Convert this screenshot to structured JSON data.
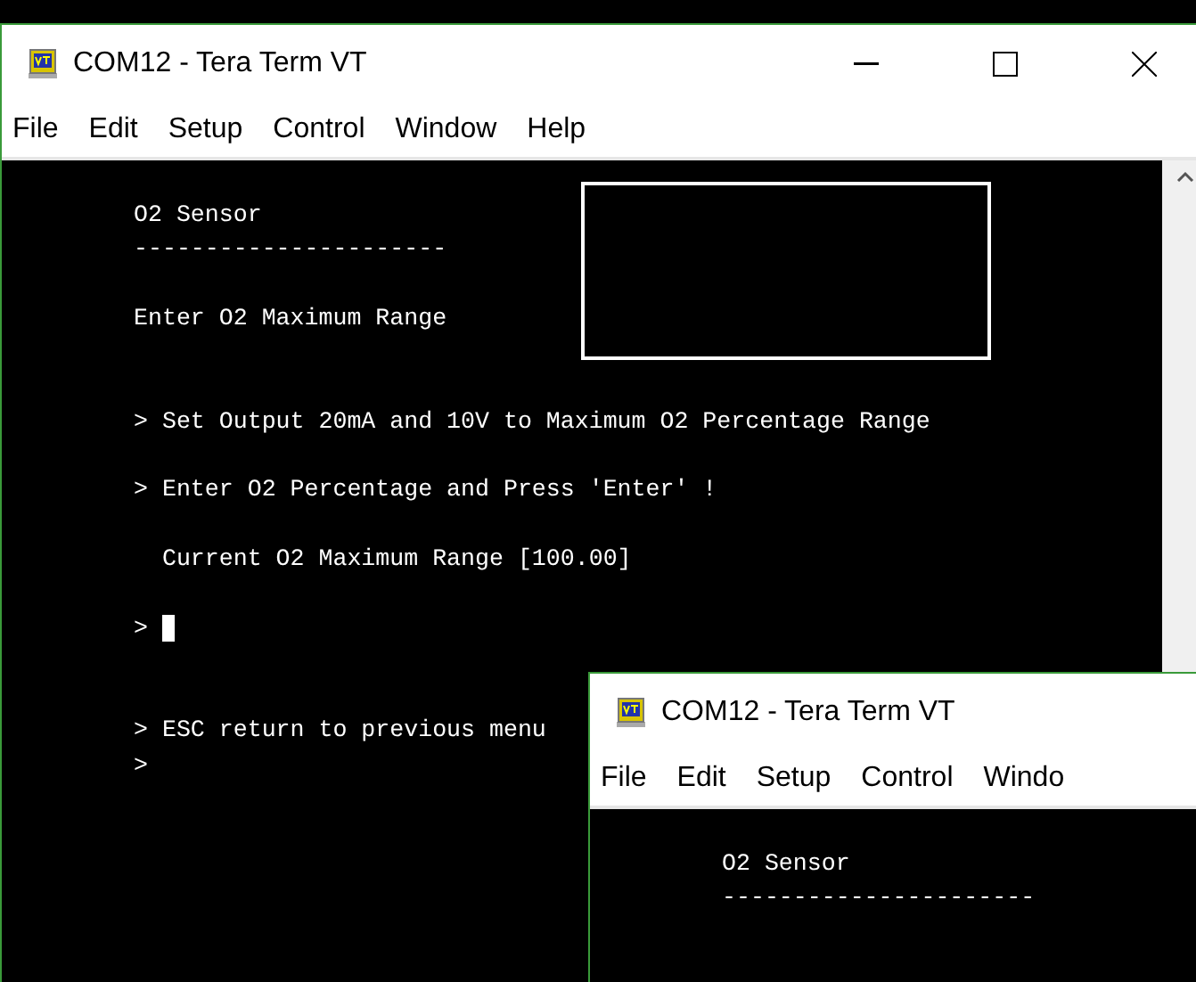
{
  "windows": [
    {
      "title": "COM12 - Tera Term VT",
      "menu": [
        "File",
        "Edit",
        "Setup",
        "Control",
        "Window",
        "Help"
      ],
      "blocks": [
        {
          "lines": [
            "O2 Sensor",
            "----------------------"
          ],
          "cursor": false
        },
        {
          "lines": [
            "Enter O2 Maximum Range"
          ],
          "cursor": false
        },
        {
          "lines": [
            "> Set Output 20mA and 10V to Maximum O2 Percentage Range"
          ],
          "cursor": false
        },
        {
          "lines": [
            "> Enter O2 Percentage and Press 'Enter' !"
          ],
          "cursor": false
        },
        {
          "lines": [
            "  Current O2 Maximum Range [100.00]"
          ],
          "cursor": false
        },
        {
          "lines": [
            ">"
          ],
          "cursor": true
        },
        {
          "lines": [
            "> ESC return to previous menu",
            ">"
          ],
          "cursor": false
        }
      ]
    },
    {
      "title": "COM12 - Tera Term VT",
      "menu": [
        "File",
        "Edit",
        "Setup",
        "Control",
        "Windo"
      ],
      "blocks": [
        {
          "lines": [
            "O2 Sensor",
            "----------------------"
          ],
          "cursor": false
        }
      ]
    }
  ]
}
